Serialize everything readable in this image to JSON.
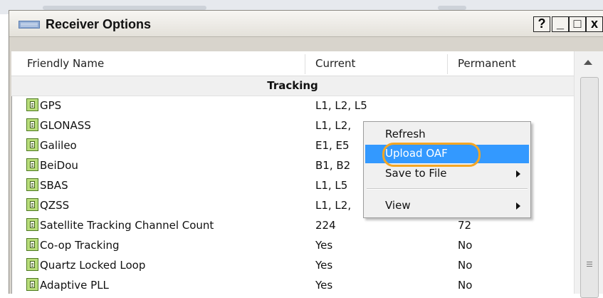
{
  "window": {
    "title": "Receiver Options",
    "buttons": {
      "help": "?",
      "minimize": "_",
      "maximize": "□",
      "close": "x"
    }
  },
  "columns": [
    "Friendly Name",
    "Current",
    "Permanent"
  ],
  "section": "Tracking",
  "rows": [
    {
      "name": "GPS",
      "current": "L1, L2, L5",
      "permanent": ""
    },
    {
      "name": "GLONASS",
      "current": "L1, L2,",
      "permanent": ""
    },
    {
      "name": "Galileo",
      "current": "E1, E5",
      "permanent": ""
    },
    {
      "name": "BeiDou",
      "current": "B1, B2",
      "permanent": ""
    },
    {
      "name": "SBAS",
      "current": "L1, L5",
      "permanent": ""
    },
    {
      "name": "QZSS",
      "current": "L1, L2,",
      "permanent": ""
    },
    {
      "name": "Satellite Tracking Channel Count",
      "current": "224",
      "permanent": "72"
    },
    {
      "name": "Co-op Tracking",
      "current": "Yes",
      "permanent": "No"
    },
    {
      "name": "Quartz Locked Loop",
      "current": "Yes",
      "permanent": "No"
    },
    {
      "name": "Adaptive PLL",
      "current": "Yes",
      "permanent": "No"
    }
  ],
  "context_menu": {
    "items": [
      {
        "label": "Refresh",
        "submenu": false,
        "highlighted": false
      },
      {
        "label": "Upload OAF",
        "submenu": false,
        "highlighted": true
      },
      {
        "label": "Save to File",
        "submenu": true,
        "highlighted": false
      },
      {
        "label": "View",
        "submenu": true,
        "highlighted": false
      }
    ]
  },
  "colors": {
    "highlight": "#3399ff",
    "annotation_outline": "#f5a623",
    "row_icon": "#b9dd7b"
  },
  "icons": {
    "app": "list-window-icon",
    "row": "config-item-icon",
    "scroll_up": "scroll-up-arrow-icon",
    "submenu": "submenu-arrow-icon"
  }
}
